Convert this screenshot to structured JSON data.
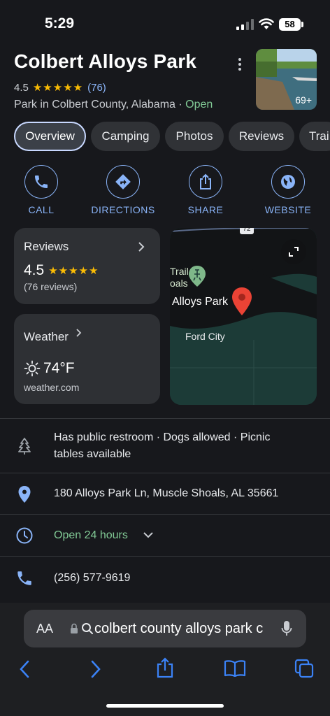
{
  "status": {
    "time": "5:29",
    "battery": "58"
  },
  "place": {
    "name": "Colbert Alloys Park",
    "rating": "4.5",
    "stars": "★★★★★",
    "reviews_count": "(76)",
    "category": "Park in Colbert County, Alabama · ",
    "open_status": "Open",
    "photo_count": "69+"
  },
  "tabs": [
    "Overview",
    "Camping",
    "Photos",
    "Reviews",
    "Trai"
  ],
  "actions": [
    "CALL",
    "DIRECTIONS",
    "SHARE",
    "WEBSITE"
  ],
  "reviews_card": {
    "title": "Reviews",
    "rating": "4.5",
    "stars": "★★★★★",
    "count": "(76 reviews)"
  },
  "weather_card": {
    "title": "Weather",
    "temp": "74°F",
    "source": "weather.com"
  },
  "map": {
    "label_trail": "Trail",
    "label_trail2": "oals",
    "label_place": "Alloys Park",
    "label_city": "Ford City",
    "route": "72"
  },
  "rows": {
    "amenities_line1": "Has public restroom · Dogs allowed · Picnic",
    "amenities_line2": "tables available",
    "address": "180 Alloys Park Ln, Muscle Shoals, AL 35661",
    "hours": "Open 24 hours",
    "phone": "(256) 577-9619"
  },
  "browser": {
    "aa": "AA",
    "url": "colbert county alloys park c"
  },
  "colors": {
    "accent": "#8ab4f8",
    "star": "#fbbc04",
    "open": "#81c995",
    "pin": "#ea4335"
  }
}
